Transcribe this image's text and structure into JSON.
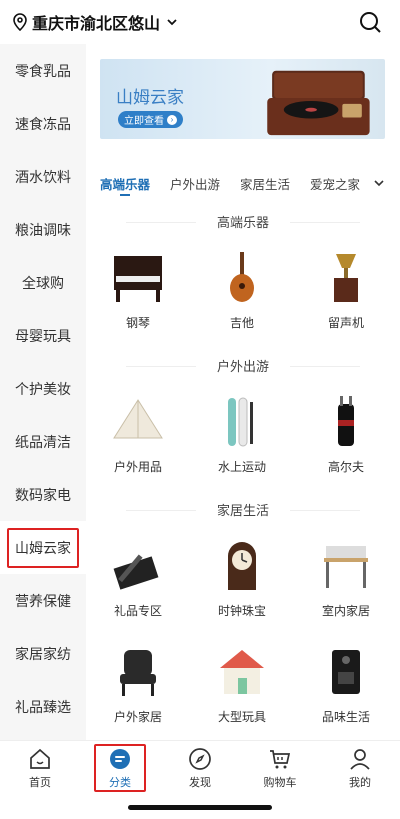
{
  "header": {
    "location": "重庆市渝北区悠山"
  },
  "sidebar": {
    "items": [
      {
        "label": "零食乳品"
      },
      {
        "label": "速食冻品"
      },
      {
        "label": "酒水饮料"
      },
      {
        "label": "粮油调味"
      },
      {
        "label": "全球购"
      },
      {
        "label": "母婴玩具"
      },
      {
        "label": "个护美妆"
      },
      {
        "label": "纸品清洁"
      },
      {
        "label": "数码家电"
      },
      {
        "label": "山姆云家"
      },
      {
        "label": "营养保健"
      },
      {
        "label": "家居家纺"
      },
      {
        "label": "礼品臻选"
      }
    ],
    "active_index": 9
  },
  "banner": {
    "title": "山姆云家",
    "button_label": "立即查看"
  },
  "tabs": [
    {
      "label": "高端乐器"
    },
    {
      "label": "户外出游"
    },
    {
      "label": "家居生活"
    },
    {
      "label": "爱宠之家"
    }
  ],
  "sections": [
    {
      "title": "高端乐器",
      "items": [
        {
          "label": "钢琴",
          "icon": "piano-icon"
        },
        {
          "label": "吉他",
          "icon": "guitar-icon"
        },
        {
          "label": "留声机",
          "icon": "gramophone-icon"
        }
      ]
    },
    {
      "title": "户外出游",
      "items": [
        {
          "label": "户外用品",
          "icon": "tent-icon"
        },
        {
          "label": "水上运动",
          "icon": "paddleboard-icon"
        },
        {
          "label": "高尔夫",
          "icon": "golf-bag-icon"
        }
      ]
    },
    {
      "title": "家居生活",
      "items": [
        {
          "label": "礼品专区",
          "icon": "pen-gift-icon"
        },
        {
          "label": "时钟珠宝",
          "icon": "clock-icon"
        },
        {
          "label": "室内家居",
          "icon": "desk-icon"
        }
      ]
    },
    {
      "title": "",
      "items": [
        {
          "label": "户外家居",
          "icon": "outdoor-chair-icon"
        },
        {
          "label": "大型玩具",
          "icon": "playhouse-icon"
        },
        {
          "label": "品味生活",
          "icon": "coffee-machine-icon"
        }
      ]
    }
  ],
  "bottom_nav": [
    {
      "label": "首页",
      "icon": "home-icon"
    },
    {
      "label": "分类",
      "icon": "category-icon"
    },
    {
      "label": "发现",
      "icon": "compass-icon"
    },
    {
      "label": "购物车",
      "icon": "cart-icon"
    },
    {
      "label": "我的",
      "icon": "user-icon"
    }
  ],
  "colors": {
    "accent": "#1f6fb5",
    "highlight_border": "#dd2222"
  }
}
